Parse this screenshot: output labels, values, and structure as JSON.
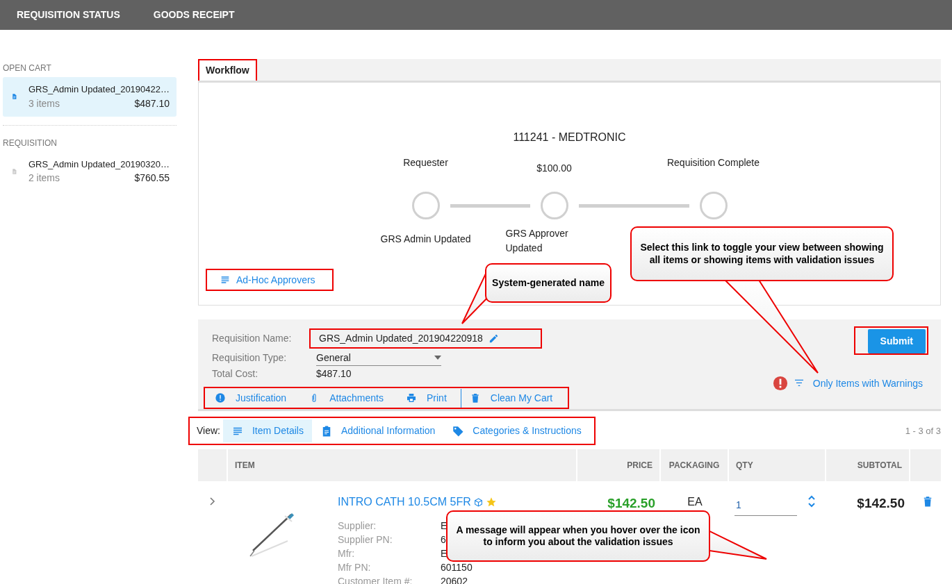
{
  "nav": [
    {
      "label": "REQUISITION STATUS"
    },
    {
      "label": "GOODS RECEIPT"
    }
  ],
  "sidebar": {
    "sections": [
      {
        "heading": "OPEN CART",
        "items": [
          {
            "name": "GRS_Admin Updated_20190422…",
            "count": "3 items",
            "total": "$487.10",
            "selected": true
          }
        ]
      },
      {
        "heading": "REQUISITION",
        "items": [
          {
            "name": "GRS_Admin Updated_20190320…",
            "count": "2 items",
            "total": "$760.55",
            "selected": false
          }
        ]
      }
    ]
  },
  "workflow": {
    "tab": "Workflow",
    "title": "111241 - MEDTRONIC",
    "steps": [
      {
        "label": "Requester",
        "approver": "GRS Admin Updated"
      },
      {
        "label": "$100.00",
        "approver": "GRS Approver Updated"
      },
      {
        "label": "Requisition Complete"
      }
    ],
    "adhoc": "Ad-Hoc Approvers"
  },
  "requisition": {
    "fields": [
      {
        "label": "Requisition Name:",
        "value": "GRS_Admin Updated_201904220918",
        "kind": "editable"
      },
      {
        "label": "Requisition Type:",
        "value": "General",
        "kind": "select"
      },
      {
        "label": "Total Cost:",
        "value": "$487.10",
        "kind": "text"
      }
    ],
    "actions": [
      {
        "label": "Justification"
      },
      {
        "label": "Attachments"
      },
      {
        "label": "Print"
      },
      {
        "label": "Clean My Cart"
      }
    ],
    "submit": "Submit",
    "warning_filter": "Only Items with Warnings"
  },
  "view": {
    "label": "View:",
    "tabs": [
      {
        "label": "Item Details",
        "selected": true
      },
      {
        "label": "Additional Information",
        "selected": false
      },
      {
        "label": "Categories & Instructions",
        "selected": false
      }
    ],
    "range": "1 - 3 of 3"
  },
  "table": {
    "columns": [
      "ITEM",
      "PRICE",
      "PACKAGING",
      "QTY",
      "SUBTOTAL"
    ],
    "rows": [
      {
        "name": "INTRO CATH 10.5CM 5FR",
        "favorite": true,
        "price": "$142.50",
        "packaging": "EA",
        "qty": "1",
        "subtotal": "$142.50",
        "details": [
          {
            "label": "Supplier:",
            "value": "E"
          },
          {
            "label": "Supplier PN:",
            "value": "6"
          },
          {
            "label": "Mfr:",
            "value": "E"
          },
          {
            "label": "Mfr PN:",
            "value": "601150"
          },
          {
            "label": "Customer Item #:",
            "value": "20602"
          }
        ]
      }
    ]
  },
  "callouts": [
    {
      "text": "System-generated name"
    },
    {
      "text": "Select this link to toggle your view between showing all items or showing items with validation issues"
    },
    {
      "text": "A message will appear when you hover over the icon to inform you about the validation issues"
    }
  ]
}
